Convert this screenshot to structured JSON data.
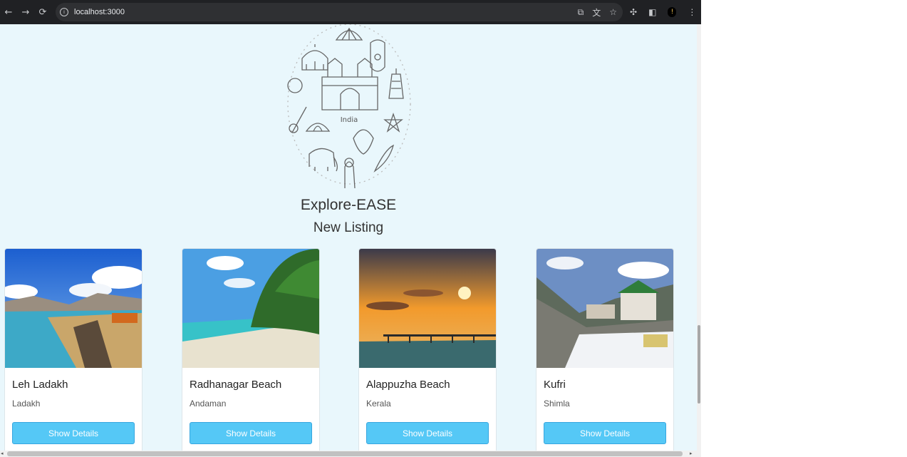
{
  "browser": {
    "url": "localhost:3000",
    "back_icon": "←",
    "forward_icon": "→",
    "reload_icon": "⟳",
    "bookmark_icon": "☆",
    "profile_initial": "!"
  },
  "site": {
    "logo_text": "India",
    "title": "Explore-EASE",
    "section_title": "New Listing"
  },
  "listings": [
    {
      "name": "Leh Ladakh",
      "location": "Ladakh",
      "button": "Show Details"
    },
    {
      "name": "Radhanagar Beach",
      "location": "Andaman",
      "button": "Show Details"
    },
    {
      "name": "Alappuzha Beach",
      "location": "Kerala",
      "button": "Show Details"
    },
    {
      "name": "Kufri",
      "location": "Shimla",
      "button": "Show Details"
    }
  ],
  "colors": {
    "page_bg": "#e9f7fc",
    "button": "#55c8f6",
    "chrome": "#202124"
  }
}
